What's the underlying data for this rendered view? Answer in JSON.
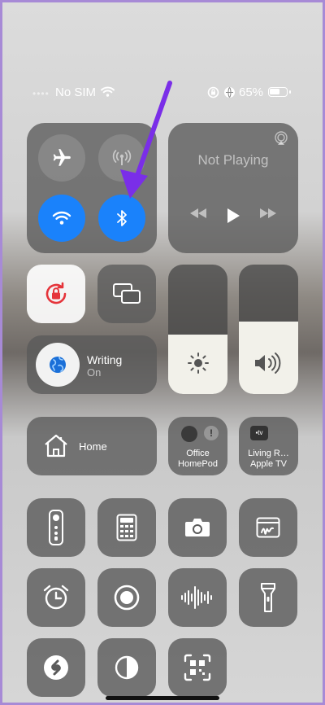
{
  "status_bar": {
    "carrier": "No SIM",
    "battery": "65%",
    "battery_level": 0.65
  },
  "now_playing": {
    "title": "Not Playing"
  },
  "focus": {
    "label": "Writing",
    "status": "On"
  },
  "home": {
    "label": "Home"
  },
  "accessories": [
    {
      "label_line1": "Office",
      "label_line2": "HomePod"
    },
    {
      "label_line1": "Living R…",
      "label_line2": "Apple TV"
    }
  ],
  "sliders": {
    "brightness_level": 0.46,
    "volume_level": 0.56
  },
  "colors": {
    "accent_blue": "#1a82fb",
    "annotation_arrow": "#7a2ee8",
    "focus_globe": "#1a6fd8"
  },
  "controls": [
    {
      "icon": "apple-tv-remote-icon"
    },
    {
      "icon": "calculator-icon"
    },
    {
      "icon": "camera-icon"
    },
    {
      "icon": "notes-icon"
    },
    {
      "icon": "alarm-icon"
    },
    {
      "icon": "screen-recording-icon"
    },
    {
      "icon": "voice-memos-icon"
    },
    {
      "icon": "flashlight-icon"
    },
    {
      "icon": "shazam-icon"
    },
    {
      "icon": "dark-mode-icon"
    },
    {
      "icon": "code-scanner-icon"
    }
  ]
}
